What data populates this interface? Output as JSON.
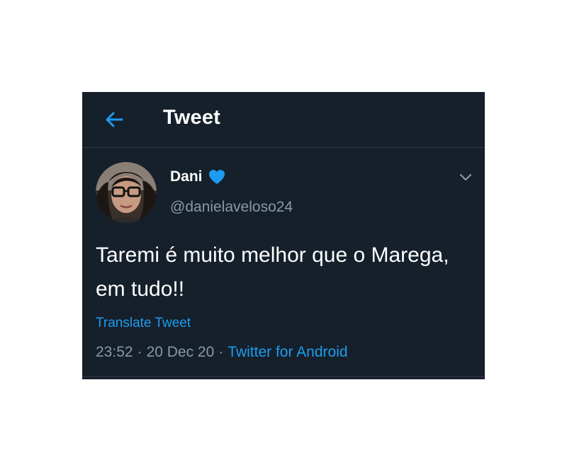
{
  "header": {
    "title": "Tweet",
    "back_icon": "arrow-left-icon"
  },
  "tweet": {
    "author_name": "Dani",
    "verified_icon": "heart-icon",
    "author_handle": "@danielaveloso24",
    "text": "Taremi é muito melhor que o Marega, em tudo!!",
    "translate_label": "Translate Tweet",
    "time": "23:52",
    "date": "20 Dec 20",
    "separator": "·",
    "source": "Twitter for Android",
    "menu_icon": "chevron-down-icon"
  },
  "colors": {
    "background": "#15202b",
    "accent": "#1d9bf0",
    "secondary_text": "#8899a6",
    "primary_text": "#ffffff"
  }
}
